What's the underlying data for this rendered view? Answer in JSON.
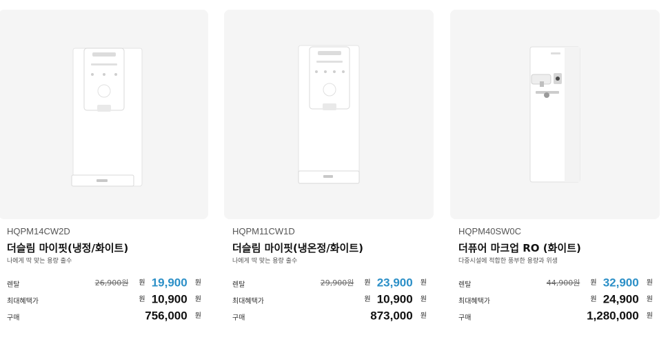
{
  "theme": {
    "accent": "#2b8fc7",
    "card_bg": "#f5f5f5",
    "text": "#111111"
  },
  "labels": {
    "rental": "렌탈",
    "max_benefit": "최대혜택가",
    "purchase": "구매",
    "won": "원"
  },
  "products": [
    {
      "model": "HQPM14CW2D",
      "name": "더슬림 마이핏(냉정/화이트)",
      "description": "나에게 딱 맞는 용량 출수",
      "image_icon": "water-purifier-slim-icon",
      "rental_original": "26,900원",
      "rental_price": "19,900",
      "max_benefit_price": "10,900",
      "purchase_price": "756,000"
    },
    {
      "model": "HQPM11CW1D",
      "name": "더슬림 마이핏(냉온정/화이트)",
      "description": "나에게 딱 맞는 용량 출수",
      "image_icon": "water-purifier-slim-icon",
      "rental_original": "29,900원",
      "rental_price": "23,900",
      "max_benefit_price": "10,900",
      "purchase_price": "873,000"
    },
    {
      "model": "HQPM40SW0C",
      "name": "더퓨어 마크업 RO (화이트)",
      "description": "다중시설에 적합한 풍부한 용량과 위생",
      "image_icon": "water-purifier-stand-icon",
      "rental_original": "44,900원",
      "rental_price": "32,900",
      "max_benefit_price": "24,900",
      "purchase_price": "1,280,000"
    }
  ]
}
